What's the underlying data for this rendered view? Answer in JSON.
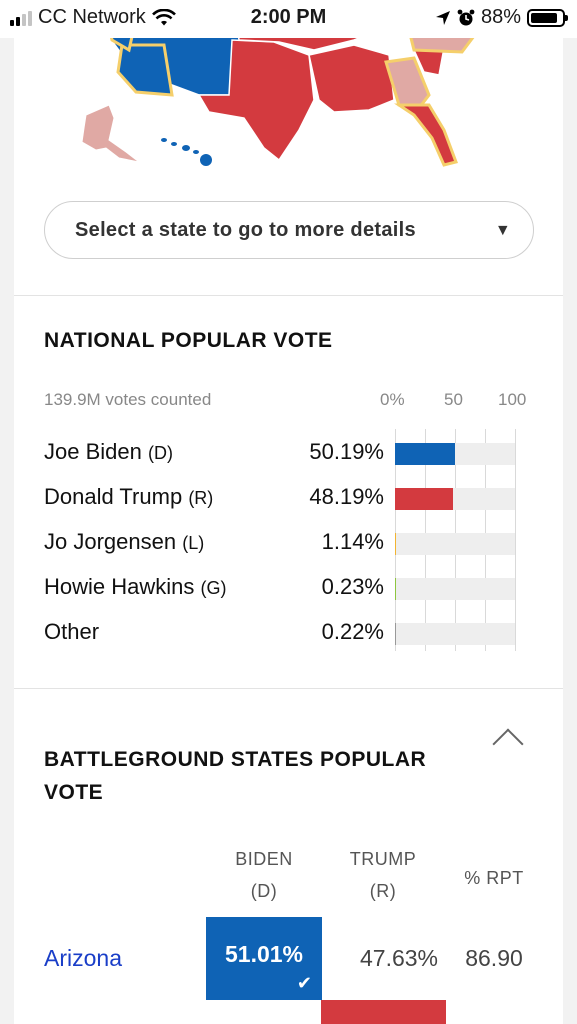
{
  "status_bar": {
    "carrier": "CC Network",
    "time": "2:00 PM",
    "battery": "88%",
    "battery_level": 0.88
  },
  "map": {
    "colors": {
      "dem": "#0f63b5",
      "rep": "#d33a3f",
      "lean_rep": "#e0a9a4",
      "battleground_outline": "#f5cf6b"
    },
    "state_select": {
      "label": "Select a state to go to more details",
      "arrow_icon": "triangle-down-icon"
    }
  },
  "national_popular_vote": {
    "title": "NATIONAL POPULAR VOTE",
    "votes_counted": "139.9M votes counted",
    "scale": [
      "0%",
      "50",
      "100"
    ],
    "candidates": [
      {
        "name": "Joe Biden",
        "party": "(D)",
        "pct_label": "50.19%",
        "pct": 50.19,
        "color": "#0f63b5"
      },
      {
        "name": "Donald Trump",
        "party": "(R)",
        "pct_label": "48.19%",
        "pct": 48.19,
        "color": "#d33a3f"
      },
      {
        "name": "Jo Jorgensen",
        "party": "(L)",
        "pct_label": "1.14%",
        "pct": 1.14,
        "color": "#f2b431"
      },
      {
        "name": "Howie Hawkins",
        "party": "(G)",
        "pct_label": "0.23%",
        "pct": 0.23,
        "color": "#8ec63f"
      },
      {
        "name": "Other",
        "party": "",
        "pct_label": "0.22%",
        "pct": 0.22,
        "color": "#999999"
      }
    ]
  },
  "battleground": {
    "title_line1": "BATTLEGROUND STATES POPULAR",
    "title_line2": "VOTE",
    "columns": {
      "biden": "BIDEN",
      "biden_party": "(D)",
      "trump": "TRUMP",
      "trump_party": "(R)",
      "rpt": "% RPT"
    },
    "rows": [
      {
        "state": "Arizona",
        "biden": "51.01%",
        "trump": "47.63%",
        "rpt": "86.90",
        "winner_icon": "checkmark-icon"
      }
    ]
  }
}
